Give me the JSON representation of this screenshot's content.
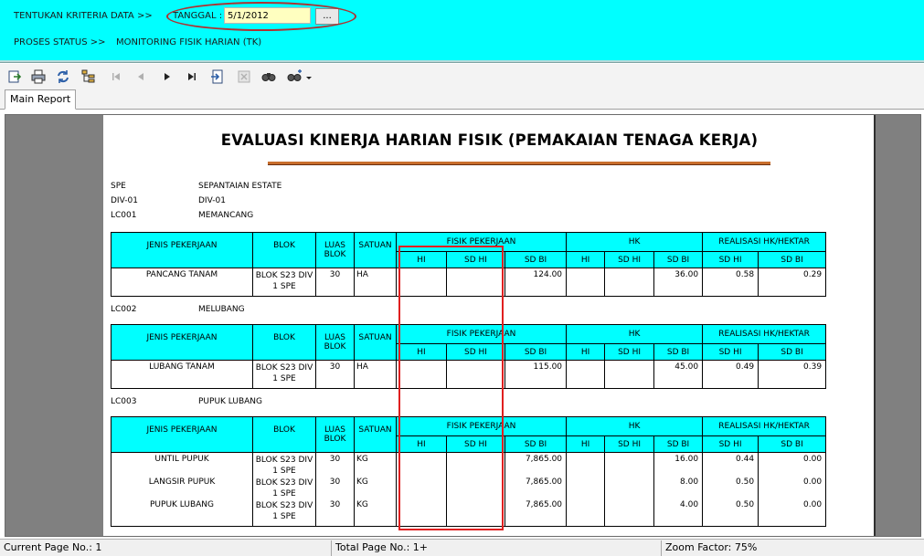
{
  "criteria": {
    "label": "TENTUKAN KRITERIA DATA >>",
    "tanggal_label": "TANGGAL :",
    "date_value": "5/1/2012",
    "date_button": "...",
    "process_label": "PROSES STATUS >>",
    "process_value": "MONITORING FISIK HARIAN (TK)"
  },
  "toolbar": {
    "icons": [
      "export-icon",
      "print-icon",
      "refresh-icon",
      "group-tree-icon",
      "first-page-icon",
      "previous-page-icon",
      "next-page-icon",
      "last-page-icon",
      "goto-page-icon",
      "stop-icon",
      "find-icon",
      "zoom-icon"
    ]
  },
  "tab": {
    "label": "Main Report"
  },
  "report": {
    "title": "EVALUASI KINERJA HARIAN FISIK (PEMAKAIAN TENAGA KERJA)",
    "info": [
      {
        "code": "SPE",
        "value": "SEPANTAIAN ESTATE"
      },
      {
        "code": "DIV-01",
        "value": "DIV-01"
      },
      {
        "code": "LC001",
        "value": "MEMANCANG"
      }
    ],
    "header": {
      "jenis": "JENIS PEKERJAAN",
      "blok": "BLOK",
      "luas1": "LUAS",
      "luas2": "BLOK",
      "satuan": "SATUAN",
      "fisik": "FISIK PEKERJAAN",
      "hk": "HK",
      "realisasi": "REALISASI HK/HEKTAR",
      "hi": "HI",
      "sdhi": "SD HI",
      "sdbi": "SD BI"
    },
    "sections": [
      {
        "code": "LC001",
        "name": "MEMANCANG",
        "rows": [
          {
            "jenis": "PANCANG TANAM",
            "blok1": "BLOK S23 DIV",
            "blok2": "1 SPE",
            "luas": "30",
            "satuan": "HA",
            "fisik_hi": "",
            "fisik_sdhi": "",
            "fisik_sdbi": "124.00",
            "hk_hi": "",
            "hk_sdhi": "",
            "hk_sdbi": "36.00",
            "real_sdhi": "0.58",
            "real_sdbi": "0.29"
          }
        ]
      },
      {
        "code": "LC002",
        "name": "MELUBANG",
        "rows": [
          {
            "jenis": "LUBANG TANAM",
            "blok1": "BLOK S23 DIV",
            "blok2": "1 SPE",
            "luas": "30",
            "satuan": "HA",
            "fisik_hi": "",
            "fisik_sdhi": "",
            "fisik_sdbi": "115.00",
            "hk_hi": "",
            "hk_sdhi": "",
            "hk_sdbi": "45.00",
            "real_sdhi": "0.49",
            "real_sdbi": "0.39"
          }
        ]
      },
      {
        "code": "LC003",
        "name": "PUPUK LUBANG",
        "rows": [
          {
            "jenis": "UNTIL PUPUK",
            "blok1": "BLOK S23 DIV",
            "blok2": "1 SPE",
            "luas": "30",
            "satuan": "KG",
            "fisik_hi": "",
            "fisik_sdhi": "",
            "fisik_sdbi": "7,865.00",
            "hk_hi": "",
            "hk_sdhi": "",
            "hk_sdbi": "16.00",
            "real_sdhi": "0.44",
            "real_sdbi": "0.00"
          },
          {
            "jenis": "LANGSIR PUPUK",
            "blok1": "BLOK S23 DIV",
            "blok2": "1 SPE",
            "luas": "30",
            "satuan": "KG",
            "fisik_hi": "",
            "fisik_sdhi": "",
            "fisik_sdbi": "7,865.00",
            "hk_hi": "",
            "hk_sdhi": "",
            "hk_sdbi": "8.00",
            "real_sdhi": "0.50",
            "real_sdbi": "0.00"
          },
          {
            "jenis": "PUPUK LUBANG",
            "blok1": "BLOK S23 DIV",
            "blok2": "1 SPE",
            "luas": "30",
            "satuan": "KG",
            "fisik_hi": "",
            "fisik_sdhi": "",
            "fisik_sdbi": "7,865.00",
            "hk_hi": "",
            "hk_sdhi": "",
            "hk_sdbi": "4.00",
            "real_sdhi": "0.50",
            "real_sdbi": "0.00"
          }
        ]
      }
    ]
  },
  "status": {
    "current_page": "Current Page No.: 1",
    "total_page": "Total Page No.: 1+",
    "zoom": "Zoom Factor: 75%"
  },
  "colors": {
    "criteria_bg": "#00ffff",
    "date_input_bg": "#ffffc0",
    "highlight_oval": "#b03030",
    "highlight_box": "#e02020",
    "title_rule": "#c86e2c",
    "table_header_bg": "#00ffff"
  }
}
